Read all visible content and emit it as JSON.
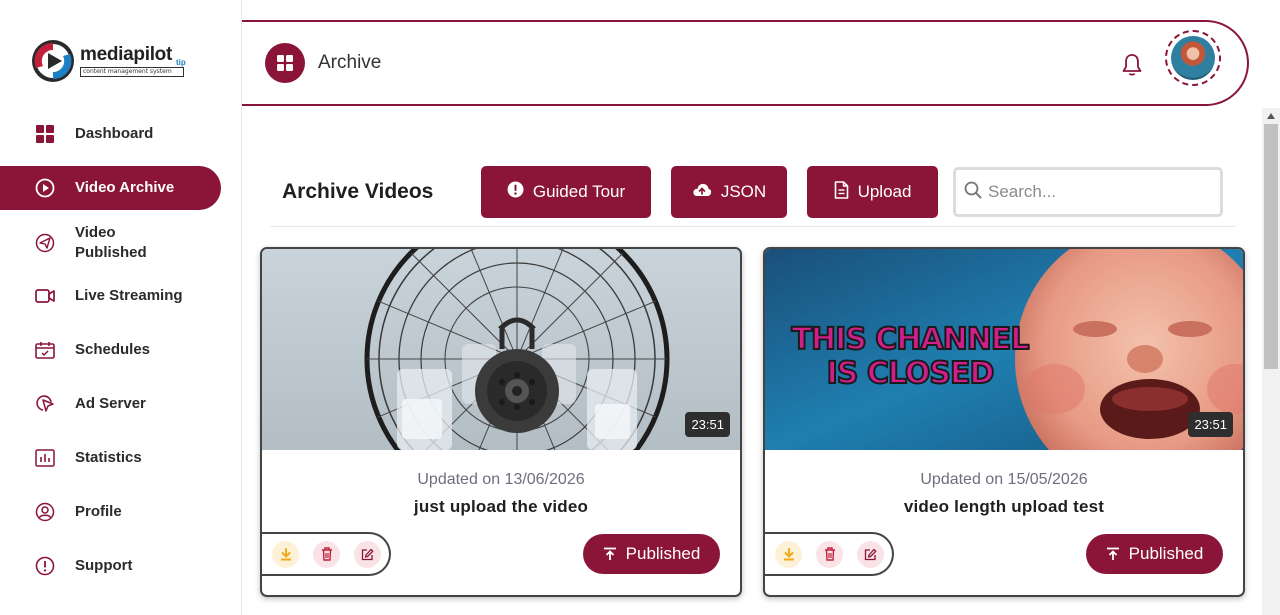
{
  "app": {
    "logo_text": "mediapilot",
    "logo_tagline": "content management system",
    "logo_suffix": "tip"
  },
  "sidebar": {
    "items": [
      {
        "label": "Dashboard",
        "icon": "grid-icon",
        "active": false
      },
      {
        "label": "Video Archive",
        "icon": "play-circle-icon",
        "active": true
      },
      {
        "label": "Video Published",
        "icon": "send-icon",
        "active": false
      },
      {
        "label": "Live Streaming",
        "icon": "video-camera-icon",
        "active": false
      },
      {
        "label": "Schedules",
        "icon": "calendar-icon",
        "active": false
      },
      {
        "label": "Ad Server",
        "icon": "cursor-target-icon",
        "active": false
      },
      {
        "label": "Statistics",
        "icon": "bar-chart-icon",
        "active": false
      },
      {
        "label": "Profile",
        "icon": "user-circle-icon",
        "active": false
      },
      {
        "label": "Support",
        "icon": "info-circle-icon",
        "active": false
      }
    ]
  },
  "header": {
    "title": "Archive",
    "badge_icon": "grid-icon",
    "notification_icon": "bell-icon"
  },
  "toolbar": {
    "section_title": "Archive Videos",
    "guided_tour_label": "Guided Tour",
    "json_label": "JSON",
    "upload_label": "Upload",
    "search_placeholder": "Search..."
  },
  "videos": [
    {
      "duration": "23:51",
      "updated": "Updated on 13/06/2026",
      "title": "just upload the video",
      "status_label": "Published",
      "thumbnail": "fan-icon"
    },
    {
      "duration": "23:51",
      "updated": "Updated on 15/05/2026",
      "title": "video length upload test",
      "status_label": "Published",
      "thumbnail_text": "THIS CHANNEL IS CLOSED"
    }
  ],
  "colors": {
    "brand": "#8a1538",
    "download_bg": "#fdf1d8",
    "delete_bg": "#f9e3e7"
  }
}
